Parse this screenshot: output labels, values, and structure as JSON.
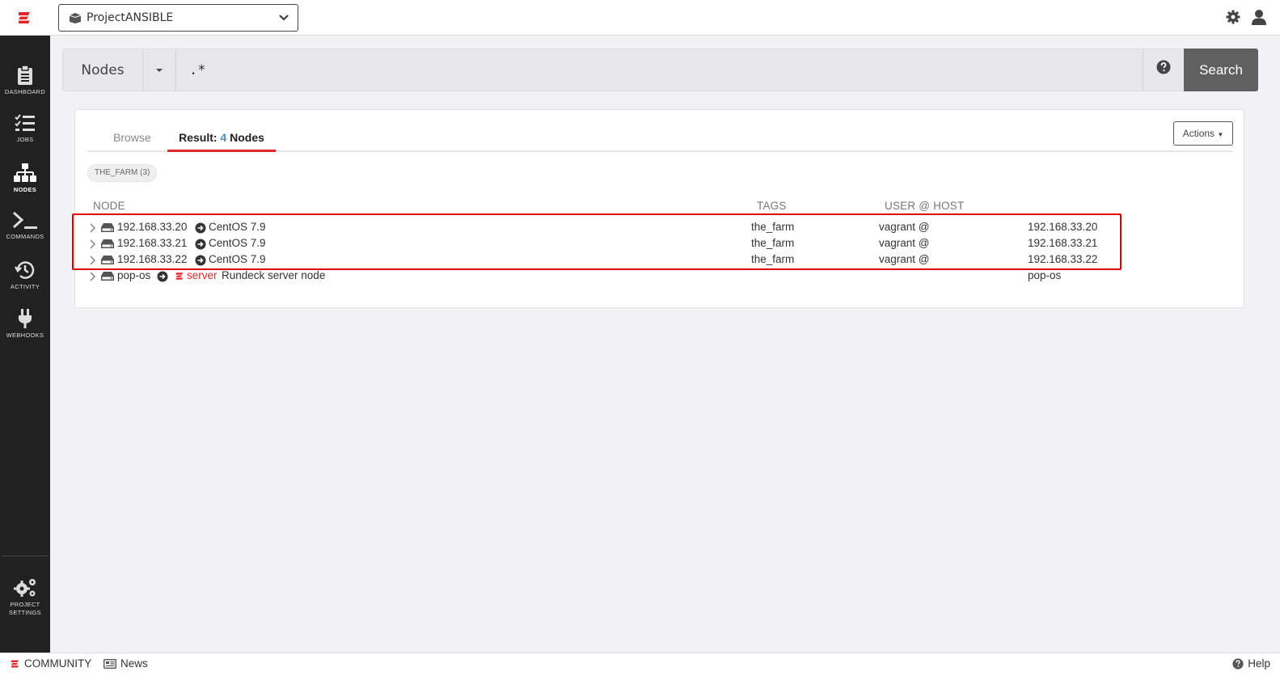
{
  "topbar": {
    "project_name": "ProjectANSIBLE"
  },
  "sidebar": {
    "items": [
      {
        "label": "DASHBOARD",
        "icon": "clipboard-icon"
      },
      {
        "label": "JOBS",
        "icon": "list-check-icon"
      },
      {
        "label": "NODES",
        "icon": "sitemap-icon"
      },
      {
        "label": "COMMANDS",
        "icon": "terminal-icon"
      },
      {
        "label": "ACTIVITY",
        "icon": "history-icon"
      },
      {
        "label": "WEBHOOKS",
        "icon": "plug-icon"
      }
    ],
    "settings": {
      "line1": "PROJECT",
      "line2": "SETTINGS",
      "icon": "gears-icon"
    }
  },
  "search": {
    "type": "Nodes",
    "query": ".*",
    "button": "Search"
  },
  "tabs": {
    "browse": "Browse",
    "result_prefix": "Result: ",
    "result_count": "4",
    "result_suffix": " Nodes"
  },
  "actions_label": "Actions",
  "tag_filter": "THE_FARM (3)",
  "columns": {
    "node": "NODE",
    "tags": "TAGS",
    "user_host": "USER @ HOST"
  },
  "nodes": [
    {
      "name": "192.168.33.20",
      "os": "CentOS 7.9",
      "tag": "the_farm",
      "user": "vagrant @",
      "host": "192.168.33.20"
    },
    {
      "name": "192.168.33.21",
      "os": "CentOS 7.9",
      "tag": "the_farm",
      "user": "vagrant @",
      "host": "192.168.33.21"
    },
    {
      "name": "192.168.33.22",
      "os": "CentOS 7.9",
      "tag": "the_farm",
      "user": "vagrant @",
      "host": "192.168.33.22"
    },
    {
      "name": "pop-os",
      "badge": "server",
      "description": "Rundeck server node",
      "host": "pop-os"
    }
  ],
  "footer": {
    "community": "COMMUNITY",
    "news": "News",
    "help": "Help"
  },
  "colors": {
    "accent": "#e0282b",
    "count": "#4a90c2",
    "sidebar_bg": "#212121",
    "highlight": "#e00000"
  }
}
